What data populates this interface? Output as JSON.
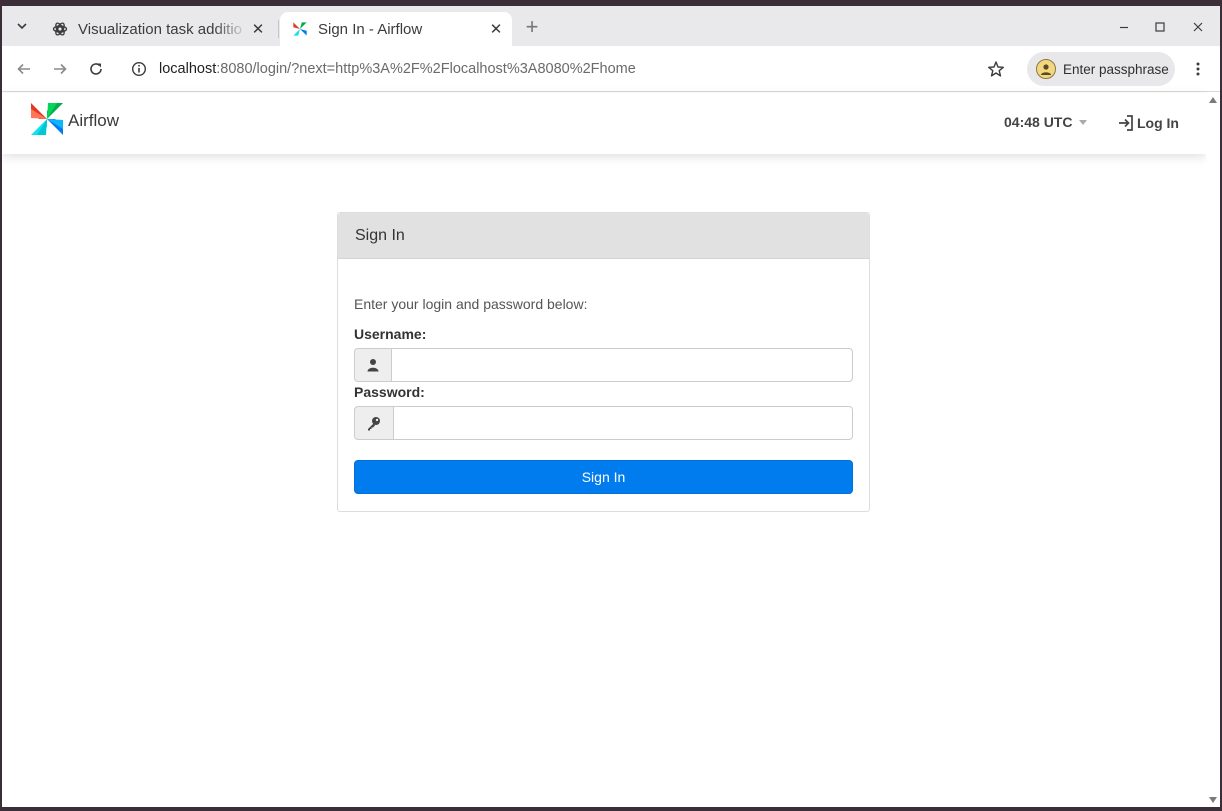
{
  "browser": {
    "tabs": [
      {
        "title": "Visualization task additio",
        "favicon": "openai-icon"
      },
      {
        "title": "Sign In - Airflow",
        "favicon": "airflow-pinwheel-icon"
      }
    ],
    "address": {
      "host": "localhost",
      "rest": ":8080/login/?next=http%3A%2F%2Flocalhost%3A8080%2Fhome"
    },
    "profile_label": "Enter passphrase"
  },
  "airflow": {
    "brand": "Airflow",
    "clock": "04:48 UTC",
    "login_link": "Log In",
    "brand_colors": [
      "#017cee",
      "#00ad46",
      "#e43921",
      "#04d659",
      "#11e1ee"
    ]
  },
  "login": {
    "heading": "Sign In",
    "intro": "Enter your login and password below:",
    "username_label": "Username:",
    "username_value": "",
    "password_label": "Password:",
    "password_value": "",
    "submit_label": "Sign In",
    "button_color": "#017cee"
  }
}
